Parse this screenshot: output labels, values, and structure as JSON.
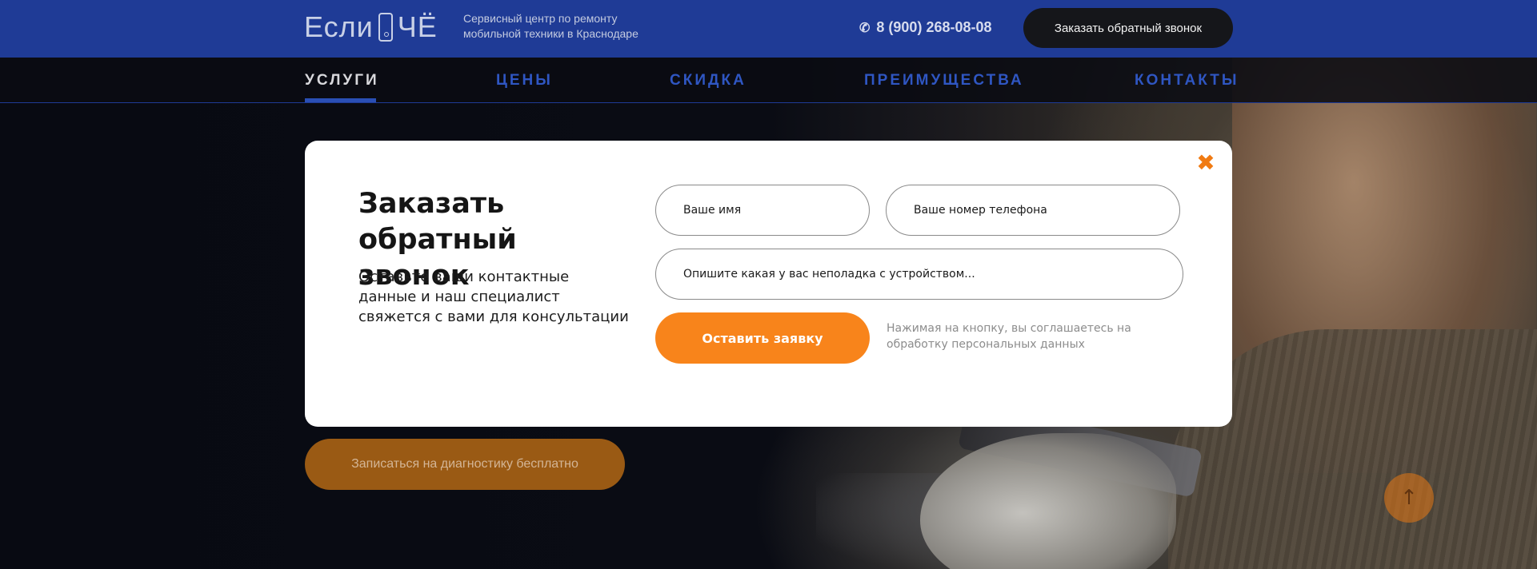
{
  "header": {
    "logo_text_left": "Если",
    "logo_text_right": "ЧЁ",
    "tagline": "Сервисный центр по ремонту мобильной техники в Краснодаре",
    "phone": "8 (900) 268-08-08",
    "callback_label": "Заказать обратный звонок",
    "icons": {
      "phone": "phone-icon",
      "logo_phone": "smartphone-icon"
    }
  },
  "nav": {
    "items": [
      {
        "label": "УСЛУГИ",
        "active": true
      },
      {
        "label": "ЦЕНЫ",
        "active": false
      },
      {
        "label": "СКИДКА",
        "active": false
      },
      {
        "label": "ПРЕИМУЩЕСТВА",
        "active": false
      },
      {
        "label": "КОНТАКТЫ",
        "active": false
      }
    ]
  },
  "hero": {
    "diagnostics_label": "Записаться на диагностику бесплатно"
  },
  "modal": {
    "title": "Заказать обратный звонок",
    "description": "Оставьте ваши контактные данные и наш специалист свяжется с вами для консультации",
    "fields": {
      "name_placeholder": "Ваше имя",
      "phone_placeholder": "Ваше номер телефона",
      "problem_placeholder": "Опишите какая у вас неполадка с устройством..."
    },
    "submit_label": "Оставить заявку",
    "consent": "Нажимая на кнопку, вы соглашаетесь на обработку персональных данных",
    "close_icon": "close-icon"
  },
  "colors": {
    "header_bg": "#1f3b96",
    "accent": "#f8841b",
    "nav_link": "#2f56c2"
  }
}
